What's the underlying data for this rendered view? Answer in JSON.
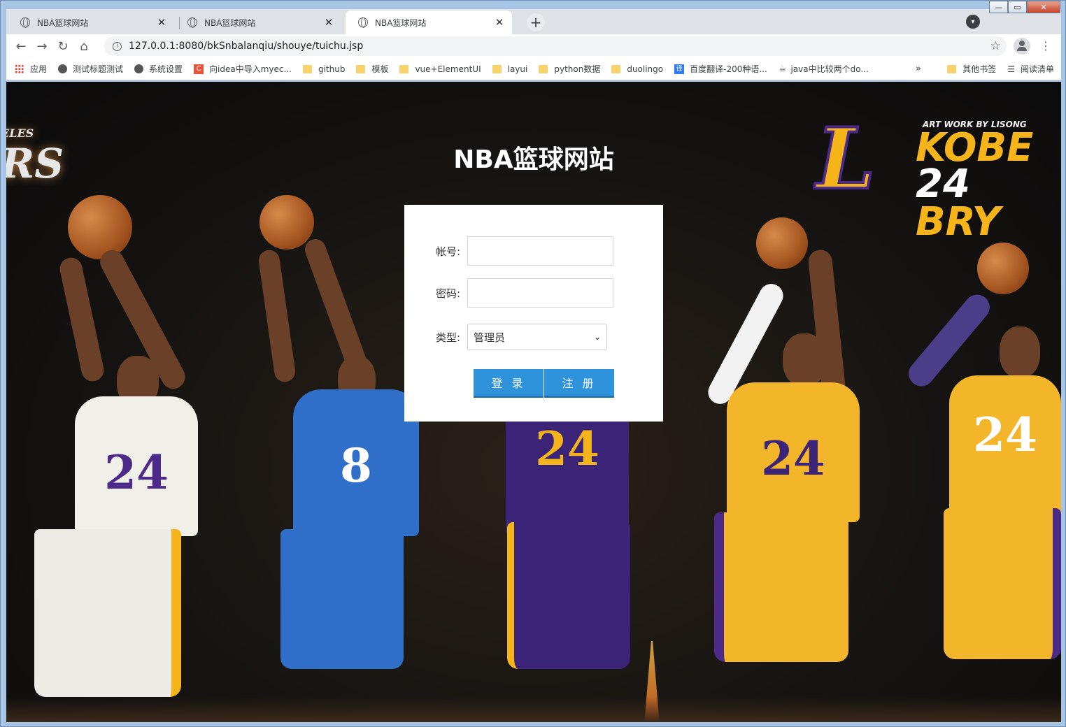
{
  "browser": {
    "tabs": [
      {
        "title": "NBA篮球网站"
      },
      {
        "title": "NBA篮球网站"
      },
      {
        "title": "NBA篮球网站"
      }
    ],
    "url": "127.0.0.1:8080/bkSnbalanqiu/shouye/tuichu.jsp",
    "bookmarks": [
      {
        "label": "应用",
        "icon": "apps-icon"
      },
      {
        "label": "测试标题测试",
        "icon": "globe-icon"
      },
      {
        "label": "系统设置",
        "icon": "globe-icon"
      },
      {
        "label": "向idea中导入myec...",
        "icon": "csdn-icon"
      },
      {
        "label": "github",
        "icon": "folder-icon"
      },
      {
        "label": "模板",
        "icon": "folder-icon"
      },
      {
        "label": "vue+ElementUI",
        "icon": "folder-icon"
      },
      {
        "label": "layui",
        "icon": "folder-icon"
      },
      {
        "label": "python数据",
        "icon": "folder-icon"
      },
      {
        "label": "duolingo",
        "icon": "folder-icon"
      },
      {
        "label": "百度翻译-200种语...",
        "icon": "translate-icon"
      },
      {
        "label": "java中比较两个do...",
        "icon": "java-icon"
      }
    ],
    "bookmarks_more": "»",
    "other_bookmarks": "其他书签",
    "reading_list": "阅读清单"
  },
  "page": {
    "title": "NBA篮球网站",
    "logo_left_top": "ELES",
    "logo_left_main": "RS",
    "kobe_logo": {
      "credit": "ART WORK BY LISONG",
      "name": "KOBE",
      "number": "24",
      "surname": "BRY"
    },
    "jersey_numbers": [
      "24",
      "8",
      "24",
      "24",
      "24"
    ]
  },
  "login": {
    "account_label": "帐号:",
    "account_value": "",
    "password_label": "密码:",
    "password_value": "",
    "type_label": "类型:",
    "type_selected": "管理员",
    "login_button": "登 录",
    "register_button": "注 册"
  },
  "colors": {
    "button_blue": "#2e93db",
    "lakers_gold": "#f5b51a",
    "lakers_purple": "#4b2a8a"
  }
}
